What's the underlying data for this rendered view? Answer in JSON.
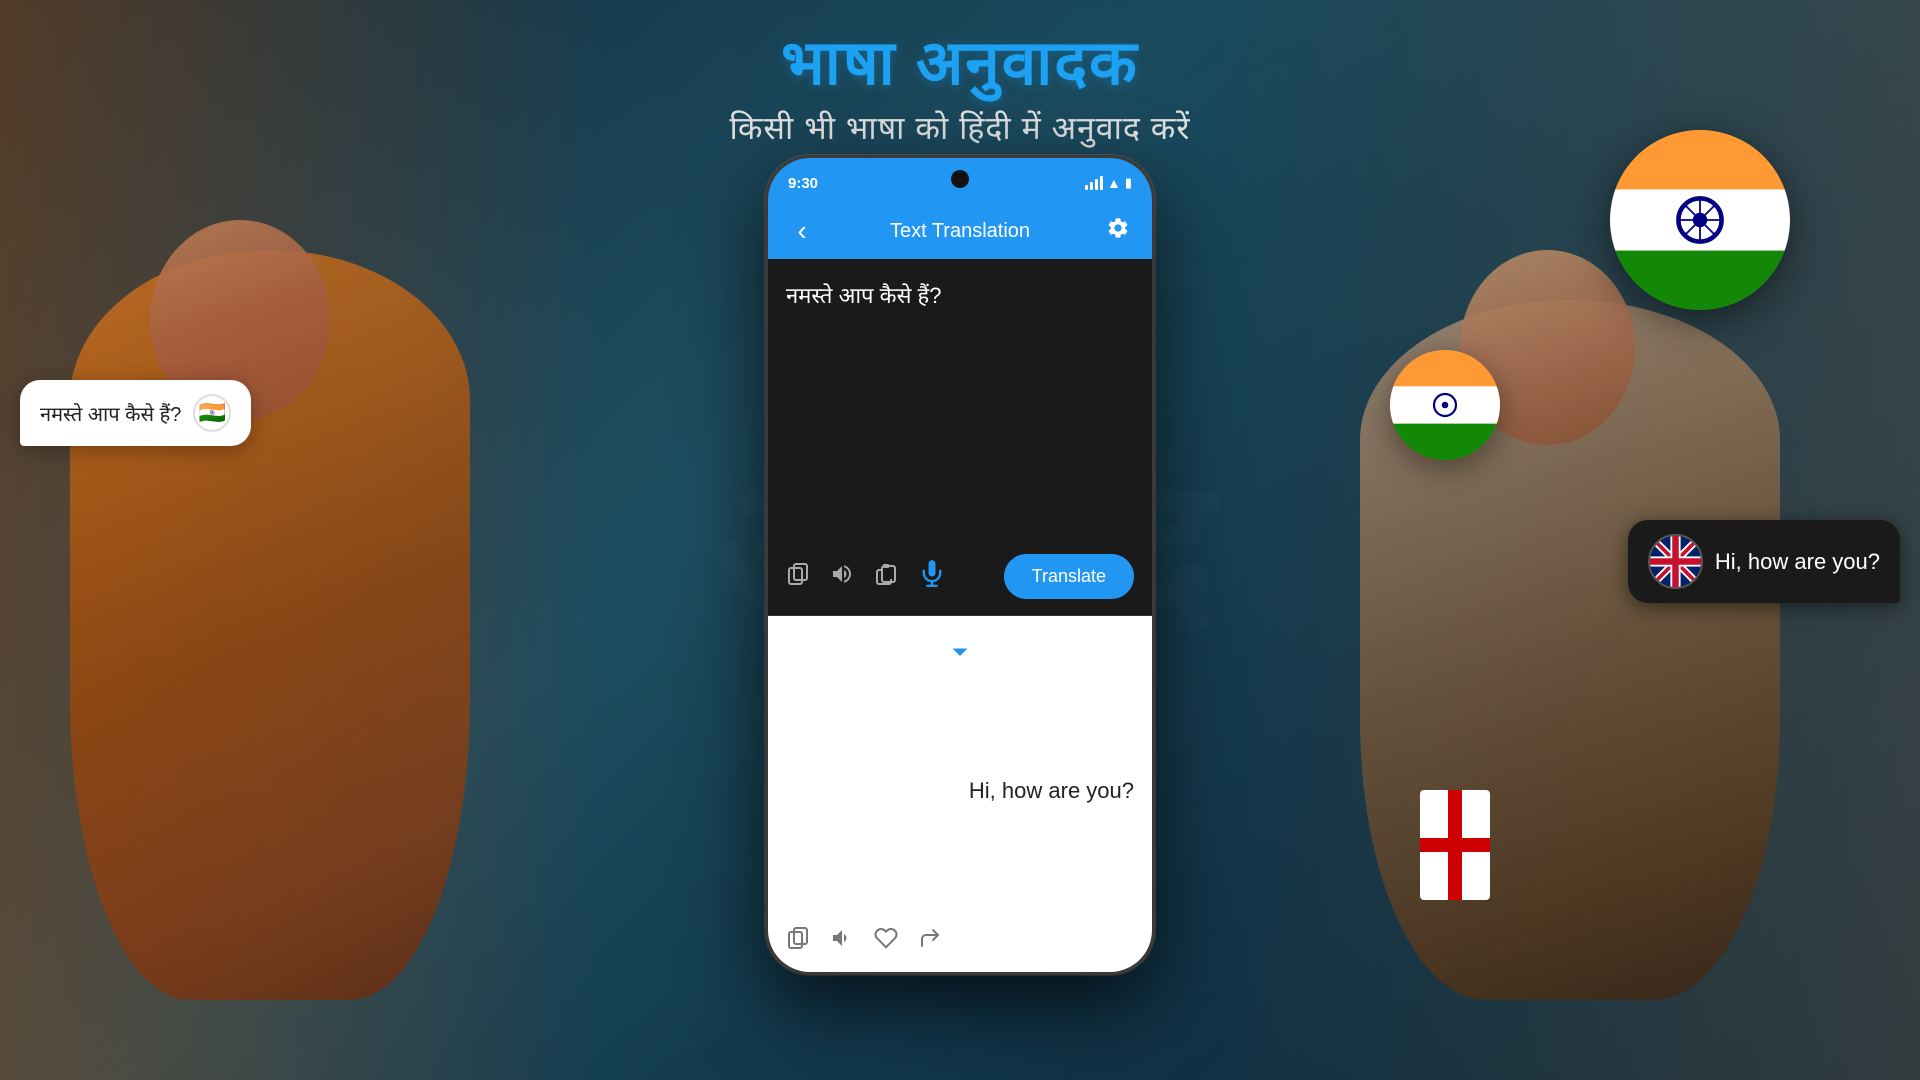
{
  "header": {
    "main_title": "भाषा अनुवादक",
    "sub_title": "किसी भी भाषा को हिंदी में अनुवाद करें"
  },
  "phone": {
    "status_time": "9:30",
    "app_title": "Text Translation",
    "back_icon": "‹",
    "settings_icon": "⚙",
    "input_text": "नमस्ते आप कैसे हैं?",
    "output_text": "Hi, how are you?",
    "translate_button": "Translate",
    "copy_icon": "⧉",
    "speaker_icon": "🔊",
    "clipboard_icon": "📋",
    "mic_icon": "🎤",
    "heart_icon": "♡",
    "share_icon": "↪"
  },
  "bubble_left": {
    "text": "नमस्ते आप कैसे हैं?",
    "flag": "🇮🇳"
  },
  "bubble_right": {
    "text": "Hi, how are you?",
    "flag": "🇬🇧"
  },
  "colors": {
    "blue": "#2196F3",
    "dark_bg": "#0d2a3a",
    "phone_bg": "#1a1a1a"
  }
}
